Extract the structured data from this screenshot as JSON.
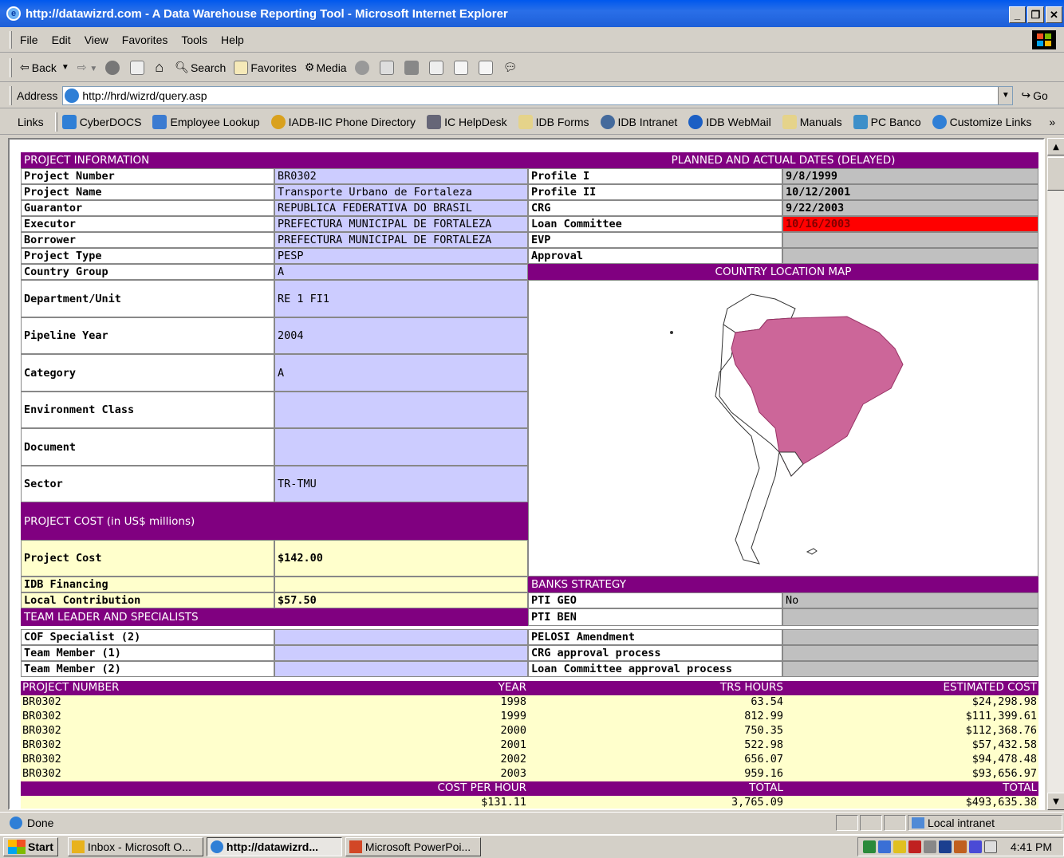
{
  "window": {
    "title": "http://datawizrd.com - A Data Warehouse Reporting Tool - Microsoft Internet Explorer"
  },
  "menu": [
    "File",
    "Edit",
    "View",
    "Favorites",
    "Tools",
    "Help"
  ],
  "toolbar": {
    "back": "Back",
    "search": "Search",
    "favorites": "Favorites",
    "media": "Media"
  },
  "address": {
    "label": "Address",
    "url": "http://hrd/wizrd/query.asp",
    "go": "Go"
  },
  "links": {
    "label": "Links",
    "items": [
      "CyberDOCS",
      "Employee Lookup",
      "IADB-IIC Phone Directory",
      "IC HelpDesk",
      "IDB Forms",
      "IDB Intranet",
      "IDB WebMail",
      "Manuals",
      "PC Banco",
      "Customize Links"
    ]
  },
  "project_info": {
    "header": "PROJECT INFORMATION",
    "rows": [
      {
        "label": "Project Number",
        "value": "BR0302"
      },
      {
        "label": "Project Name",
        "value": "Transporte Urbano de Fortaleza"
      },
      {
        "label": "Guarantor",
        "value": "REPUBLICA FEDERATIVA DO BRASIL"
      },
      {
        "label": "Executor",
        "value": "PREFECTURA MUNICIPAL DE FORTALEZA"
      },
      {
        "label": "Borrower",
        "value": "PREFECTURA MUNICIPAL DE FORTALEZA"
      },
      {
        "label": "Project Type",
        "value": "PESP"
      },
      {
        "label": "Country Group",
        "value": "A"
      },
      {
        "label": "Department/Unit",
        "value": "RE 1 FI1"
      },
      {
        "label": "Pipeline Year",
        "value": "2004"
      },
      {
        "label": "Category",
        "value": "A"
      },
      {
        "label": "Environment Class",
        "value": ""
      },
      {
        "label": "Document",
        "value": ""
      },
      {
        "label": "Sector",
        "value": "TR-TMU"
      }
    ]
  },
  "dates": {
    "header": "PLANNED AND ACTUAL DATES (DELAYED)",
    "rows": [
      {
        "label": "Profile I",
        "value": "9/8/1999"
      },
      {
        "label": "Profile II",
        "value": "10/12/2001"
      },
      {
        "label": "CRG",
        "value": "9/22/2003"
      },
      {
        "label": "Loan Committee",
        "value": "10/16/2003",
        "status_color": "#ff0000"
      },
      {
        "label": "EVP",
        "value": ""
      },
      {
        "label": "Approval",
        "value": ""
      }
    ]
  },
  "map": {
    "header": "COUNTRY LOCATION MAP",
    "highlight_color": "#cc6699"
  },
  "cost": {
    "header": "PROJECT COST (in US$ millions)",
    "rows": [
      {
        "label": "Project Cost",
        "value": "$142.00"
      },
      {
        "label": "IDB Financing",
        "value": ""
      },
      {
        "label": "Local Contribution",
        "value": "$57.50"
      }
    ]
  },
  "team": {
    "header": "TEAM LEADER AND SPECIALISTS",
    "rows": [
      {
        "label": "COF Specialist (2)",
        "value": ""
      },
      {
        "label": "Team Member (1)",
        "value": ""
      },
      {
        "label": "Team Member (2)",
        "value": ""
      }
    ]
  },
  "strategy": {
    "header": "BANKS STRATEGY",
    "rows": [
      {
        "label": "PTI GEO",
        "value": "No"
      },
      {
        "label": "PTI BEN",
        "value": ""
      },
      {
        "label": "PELOSI Amendment",
        "value": ""
      },
      {
        "label": "CRG approval process",
        "value": ""
      },
      {
        "label": "Loan Committee approval process",
        "value": ""
      }
    ]
  },
  "hours_table": {
    "headers": [
      "PROJECT NUMBER",
      "YEAR",
      "TRS HOURS",
      "ESTIMATED COST"
    ],
    "rows": [
      [
        "BR0302",
        "1998",
        "63.54",
        "$24,298.98"
      ],
      [
        "BR0302",
        "1999",
        "812.99",
        "$111,399.61"
      ],
      [
        "BR0302",
        "2000",
        "750.35",
        "$112,368.76"
      ],
      [
        "BR0302",
        "2001",
        "522.98",
        "$57,432.58"
      ],
      [
        "BR0302",
        "2002",
        "656.07",
        "$94,478.48"
      ],
      [
        "BR0302",
        "2003",
        "959.16",
        "$93,656.97"
      ]
    ],
    "totals_headers": [
      "COST PER HOUR",
      "TOTAL",
      "TOTAL"
    ],
    "totals": [
      "$131.11",
      "3,765.09",
      "$493,635.38"
    ]
  },
  "status": {
    "left": "Done",
    "zone": "Local intranet"
  },
  "taskbar": {
    "start": "Start",
    "tasks": [
      "Inbox - Microsoft O...",
      "http://datawizrd...",
      "Microsoft PowerPoi..."
    ],
    "clock": "4:41 PM"
  }
}
